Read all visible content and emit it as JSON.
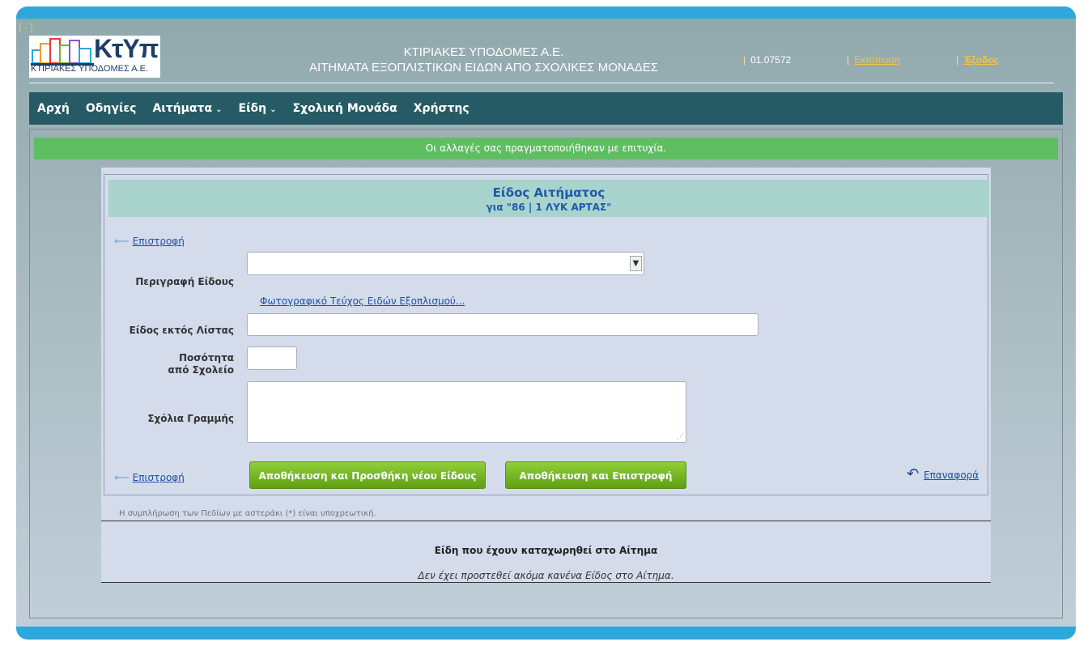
{
  "header": {
    "collapse_label": "[-]",
    "logo_brand": "ΚτΥπ",
    "logo_sub": "ΚΤΙΡΙΑΚΕΣ ΥΠΟΔΟΜΕΣ Α.Ε.",
    "title_line1": "ΚΤΙΡΙΑΚΕΣ ΥΠΟΔΟΜΕΣ Α.Ε.",
    "title_line2": "ΑΙΤΗΜΑΤΑ ΕΞΟΠΛΙΣΤΙΚΩΝ ΕΙΔΩΝ ΑΠΟ ΣΧΟΛΙΚΕΣ ΜΟΝΑΔΕΣ",
    "user_code": "01.07572",
    "print_label": "Εκτύπωση",
    "logout_label": "Έξοδος",
    "separator": "|"
  },
  "nav": {
    "items": [
      {
        "label": "Αρχή"
      },
      {
        "label": "Οδηγίες"
      },
      {
        "label": "Αιτήματα"
      },
      {
        "label": "Είδη"
      },
      {
        "label": "Σχολική Μονάδα"
      },
      {
        "label": "Χρήστης"
      }
    ],
    "chevron": "⌄"
  },
  "success_message": "Οι αλλαγές σας πραγματοποιήθηκαν με επιτυχία.",
  "panel": {
    "title": "Είδος Αιτήματος",
    "subtitle": "για \"86 | 1 ΛΥΚ ΑΡΤΑΣ\"",
    "back_label": "Επιστροφή",
    "form": {
      "description_label": "Περιγραφή Είδους",
      "description_value": "",
      "catalog_link": "Φωτογραφικό Τεύχος Ειδών Εξοπλισμού...",
      "offlist_label": "Είδος εκτός Λίστας",
      "offlist_value": "",
      "quantity_label_1": "Ποσότητα",
      "quantity_label_2": "από Σχολείο",
      "quantity_value": "",
      "comments_label": "Σχόλια Γραμμής",
      "comments_value": ""
    },
    "buttons": {
      "save_add": "Αποθήκευση και Προσθήκη νέου Είδους",
      "save_return": "Αποθήκευση και Επιστροφή",
      "reset": "Επαναφορά"
    },
    "required_note": "Η συμπλήρωση των Πεδίων με αστεράκι (*) είναι υποχρεωτική.",
    "items_title": "Είδη που έχουν καταχωρηθεί στο Αίτημα",
    "items_empty": "Δεν έχει προστεθεί ακόμα κανένα Είδος στο Αίτημα."
  },
  "colors": {
    "accent_bar": "#2ea7dc",
    "nav_bg": "#265b66",
    "success_bg": "#5fbd62",
    "button_green": "#6fae1f",
    "title_bg": "#a9d3cd"
  }
}
